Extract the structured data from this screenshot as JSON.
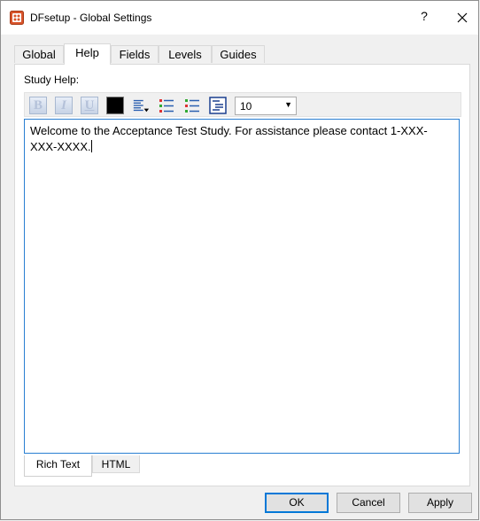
{
  "window": {
    "title": "DFsetup - Global Settings",
    "help_glyph": "?"
  },
  "tabs": [
    {
      "label": "Global"
    },
    {
      "label": "Help"
    },
    {
      "label": "Fields"
    },
    {
      "label": "Levels"
    },
    {
      "label": "Guides"
    }
  ],
  "active_tab": "Help",
  "help_panel": {
    "section_label": "Study Help:",
    "toolbar": {
      "bold": "B",
      "italic": "I",
      "underline": "U",
      "text_color": "#000000",
      "font_size": "10"
    },
    "content": "Welcome to the Acceptance Test Study. For assistance please contact 1-XXX-XXX-XXXX.",
    "mode_tabs": [
      {
        "label": "Rich Text"
      },
      {
        "label": "HTML"
      }
    ],
    "active_mode": "Rich Text"
  },
  "buttons": {
    "ok": "OK",
    "cancel": "Cancel",
    "apply": "Apply"
  },
  "colors": {
    "accent": "#0078d7",
    "editor_border": "#2a7fd2"
  }
}
